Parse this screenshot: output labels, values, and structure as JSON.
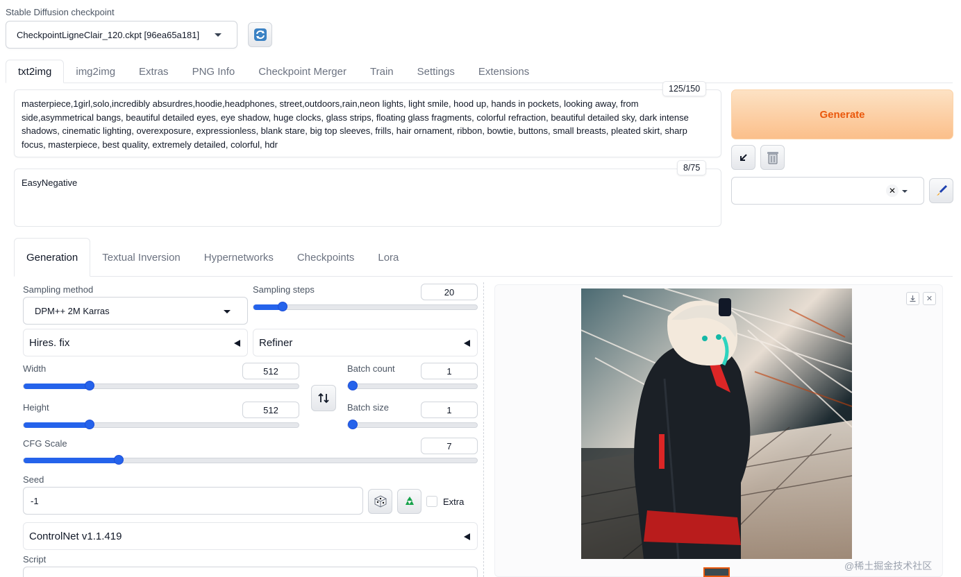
{
  "checkpoint": {
    "label": "Stable Diffusion checkpoint",
    "value": "CheckpointLigneClair_120.ckpt [96ea65a181]"
  },
  "main_tabs": [
    "txt2img",
    "img2img",
    "Extras",
    "PNG Info",
    "Checkpoint Merger",
    "Train",
    "Settings",
    "Extensions"
  ],
  "prompt": {
    "counter": "125/150",
    "lines": [
      "masterpiece,1girl,solo,incredibly absurdres,hoodie,headphones, street,outdoors,rain,neon lights,  light smile, hood up, hands in pockets, looking away, from",
      "side,asymmetrical bangs, beautiful detailed eyes, eye shadow, huge clocks, glass strips, floating glass fragments, colorful refraction, beautiful detailed sky, dark intense",
      "shadows, cinematic lighting, overexposure, expressionless, blank stare, big top sleeves, frills, hair ornament, ribbon, bowtie, buttons, small breasts, pleated skirt, sharp",
      "focus, masterpiece, best quality, extremely detailed, colorful, hdr"
    ]
  },
  "negative_prompt": {
    "counter": "8/75",
    "text": "EasyNegative"
  },
  "generate_label": "Generate",
  "sub_tabs": [
    "Generation",
    "Textual Inversion",
    "Hypernetworks",
    "Checkpoints",
    "Lora"
  ],
  "sampling": {
    "method_label": "Sampling method",
    "method_value": "DPM++ 2M Karras",
    "steps_label": "Sampling steps",
    "steps_value": "20",
    "steps_fraction": 0.13
  },
  "accordions": {
    "hires": "Hires. fix",
    "refiner": "Refiner",
    "controlnet": "ControlNet v1.1.419"
  },
  "width": {
    "label": "Width",
    "value": "512",
    "fraction": 0.24
  },
  "height": {
    "label": "Height",
    "value": "512",
    "fraction": 0.24
  },
  "batch_count": {
    "label": "Batch count",
    "value": "1",
    "fraction": 0.0
  },
  "batch_size": {
    "label": "Batch size",
    "value": "1",
    "fraction": 0.0
  },
  "cfg": {
    "label": "CFG Scale",
    "value": "7",
    "fraction": 0.21
  },
  "seed": {
    "label": "Seed",
    "value": "-1",
    "extra_label": "Extra"
  },
  "script_label": "Script",
  "watermark": "@稀土掘金技术社区",
  "colors": {
    "accent": "#2563eb",
    "generate_text": "#ea580c"
  }
}
